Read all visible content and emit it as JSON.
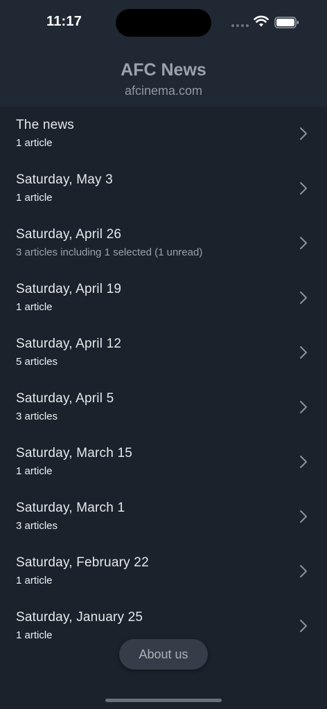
{
  "status_bar": {
    "time": "11:17"
  },
  "header": {
    "title": "AFC News",
    "subtitle": "afcinema.com"
  },
  "list": {
    "items": [
      {
        "title": "The news",
        "subtitle": "1 article",
        "muted": false
      },
      {
        "title": "Saturday, May 3",
        "subtitle": "1 article",
        "muted": false
      },
      {
        "title": "Saturday, April 26",
        "subtitle": "3 articles including 1 selected (1 unread)",
        "muted": true
      },
      {
        "title": "Saturday, April 19",
        "subtitle": "1 article",
        "muted": false
      },
      {
        "title": "Saturday, April 12",
        "subtitle": "5 articles",
        "muted": false
      },
      {
        "title": "Saturday, April 5",
        "subtitle": "3 articles",
        "muted": false
      },
      {
        "title": "Saturday, March 15",
        "subtitle": "1 article",
        "muted": false
      },
      {
        "title": "Saturday, March 1",
        "subtitle": "3 articles",
        "muted": false
      },
      {
        "title": "Saturday, February 22",
        "subtitle": "1 article",
        "muted": false
      },
      {
        "title": "Saturday, January 25",
        "subtitle": "1 article",
        "muted": false
      }
    ]
  },
  "footer": {
    "about_label": "About us"
  },
  "icons": {
    "row_chevron": "chevron-right-icon",
    "wifi": "wifi-icon",
    "battery": "battery-icon",
    "signal": "cellular-signal-icon"
  },
  "colors": {
    "background": "#1b222c",
    "header_background": "#202833",
    "button_background": "#363d48"
  }
}
